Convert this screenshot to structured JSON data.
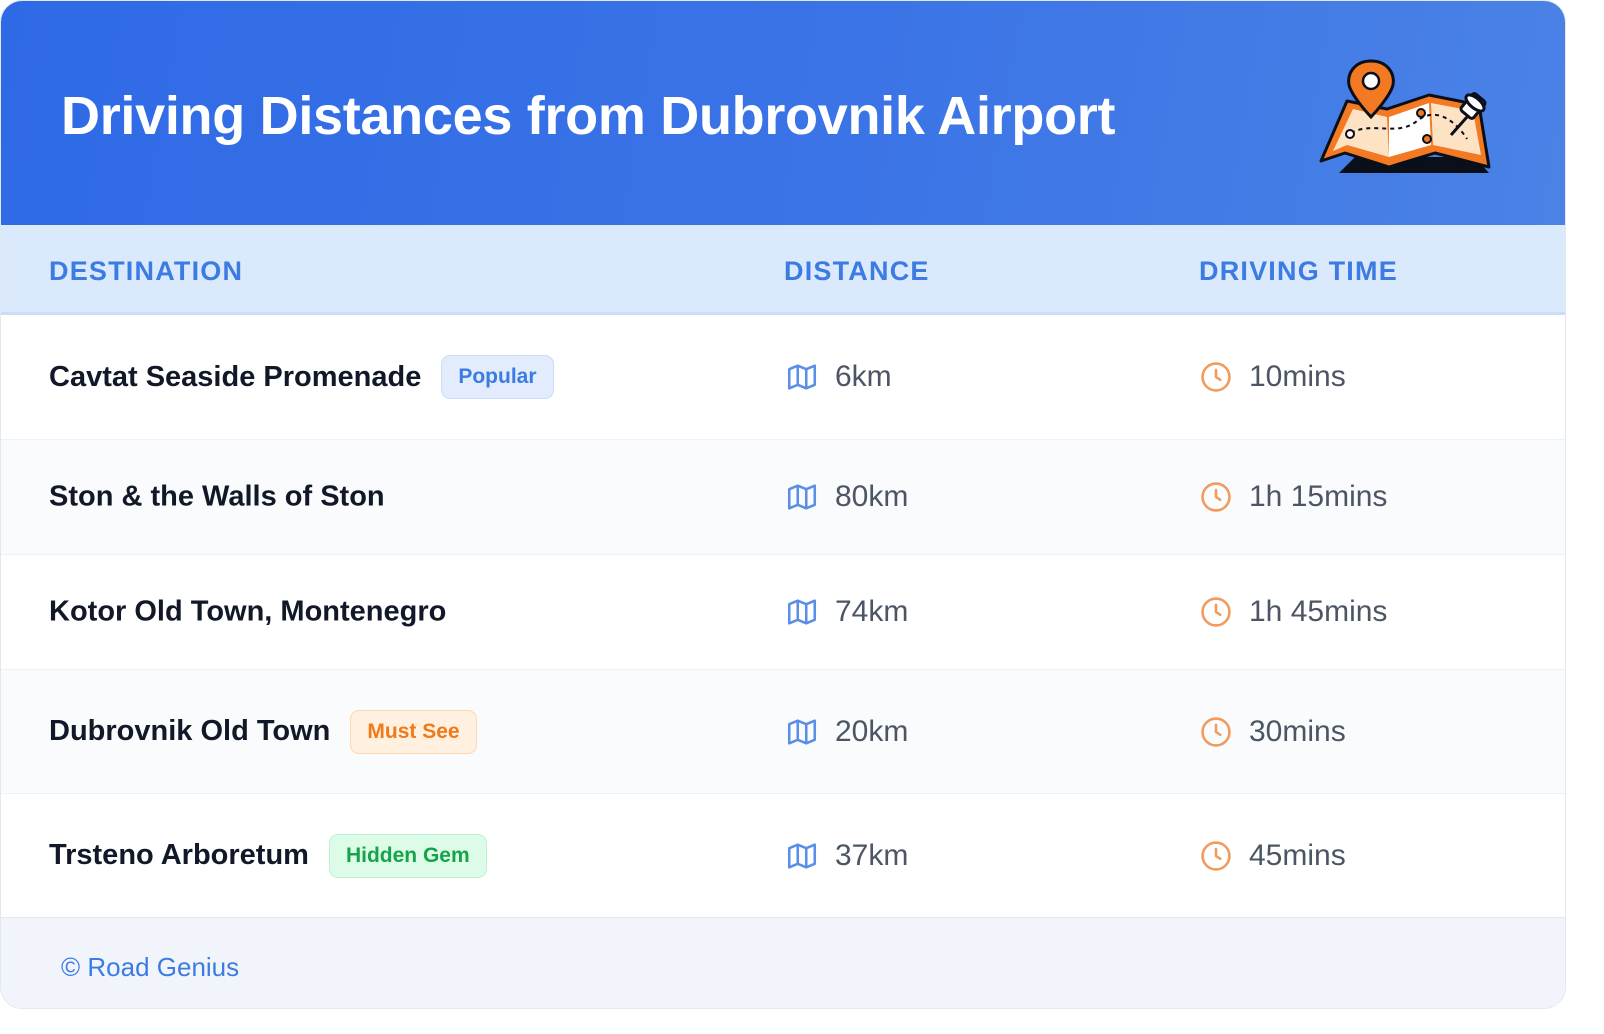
{
  "header": {
    "title": "Driving Distances from Dubrovnik Airport",
    "illustration": "folded-map-with-pins-icon"
  },
  "columns": {
    "destination": "DESTINATION",
    "distance": "DISTANCE",
    "driving_time": "DRIVING TIME"
  },
  "rows": [
    {
      "destination": "Cavtat Seaside Promenade",
      "badge": "Popular",
      "badge_style": "blue",
      "distance": "6km",
      "time": "10mins"
    },
    {
      "destination": "Ston & the Walls of Ston",
      "badge": "",
      "badge_style": "",
      "distance": "80km",
      "time": "1h 15mins"
    },
    {
      "destination": "Kotor Old Town, Montenegro",
      "badge": "",
      "badge_style": "",
      "distance": "74km",
      "time": "1h 45mins"
    },
    {
      "destination": "Dubrovnik Old Town",
      "badge": "Must See",
      "badge_style": "orange",
      "distance": "20km",
      "time": "30mins"
    },
    {
      "destination": "Trsteno Arboretum",
      "badge": "Hidden Gem",
      "badge_style": "green",
      "distance": "37km",
      "time": "45mins"
    }
  ],
  "icons": {
    "distance": "map-icon",
    "time": "clock-icon"
  },
  "colors": {
    "header_start": "#2f6ae6",
    "header_end": "#4a82e6",
    "accent_blue": "#3b7be2",
    "map_icon": "#5b8ee6",
    "clock_icon": "#f29a5c",
    "badge_orange": "#f07a1a",
    "badge_green": "#16a34a"
  },
  "footer": {
    "text": "© Road Genius"
  }
}
